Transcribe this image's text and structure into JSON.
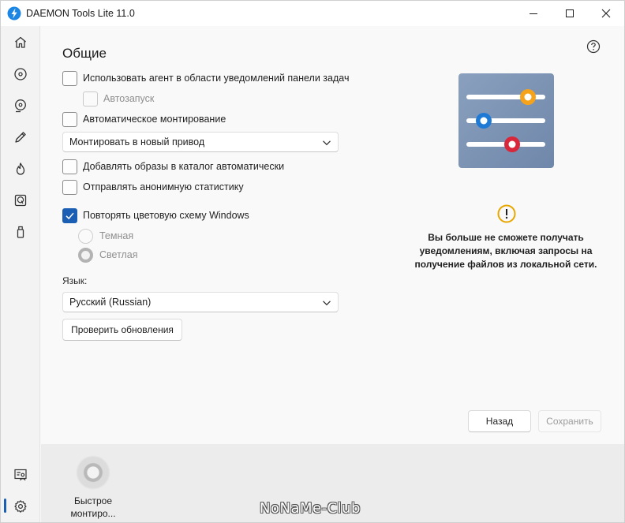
{
  "window": {
    "title": "DAEMON Tools Lite 11.0",
    "accent_color": "#1a5fb4",
    "controls": [
      "minimize-icon",
      "maximize-icon",
      "close-icon"
    ]
  },
  "rail": {
    "top_items": [
      "home-icon",
      "disc-icon",
      "disc-image-icon",
      "pencil-icon",
      "flame-icon",
      "virtual-hdd-icon",
      "usb-icon"
    ],
    "bottom_items": [
      "license-icon",
      "settings-icon"
    ],
    "active": "settings-icon"
  },
  "general": {
    "title": "Общие",
    "agent_checkbox": {
      "label": "Использовать агент в области уведомлений панели задач",
      "checked": false
    },
    "autostart_checkbox": {
      "label": "Автозапуск",
      "checked": false,
      "disabled": true
    },
    "automount_checkbox": {
      "label": "Автоматическое монтирование",
      "checked": false
    },
    "mount_select": {
      "value": "Монтировать в новый привод"
    },
    "catalog_checkbox": {
      "label": "Добавлять образы в каталог автоматически",
      "checked": false
    },
    "stats_checkbox": {
      "label": "Отправлять анонимную статистику",
      "checked": false
    },
    "color_scheme_checkbox": {
      "label": "Повторять цветовую схему Windows",
      "checked": true
    },
    "theme_dark": {
      "label": "Темная",
      "selected": false
    },
    "theme_light": {
      "label": "Светлая",
      "selected": true
    },
    "language_label": "Язык:",
    "language_select": {
      "value": "Русский (Russian)"
    },
    "check_updates_button": "Проверить обновления"
  },
  "warning": {
    "text": "Вы больше не сможете получать уведомлениям, включая запросы на получение файлов из локальной сети.",
    "icon": "warning-icon",
    "color": "#e8a700"
  },
  "illustration": {
    "background": "#7c93b3",
    "slider_colors": [
      "#f4a31b",
      "#1f7ad6",
      "#d8263a"
    ]
  },
  "footer": {
    "back_button": "Назад",
    "save_button": "Сохранить"
  },
  "quick_mount": {
    "label": "Быстрое монтиро..."
  },
  "watermark": "NoNaMe-Club"
}
